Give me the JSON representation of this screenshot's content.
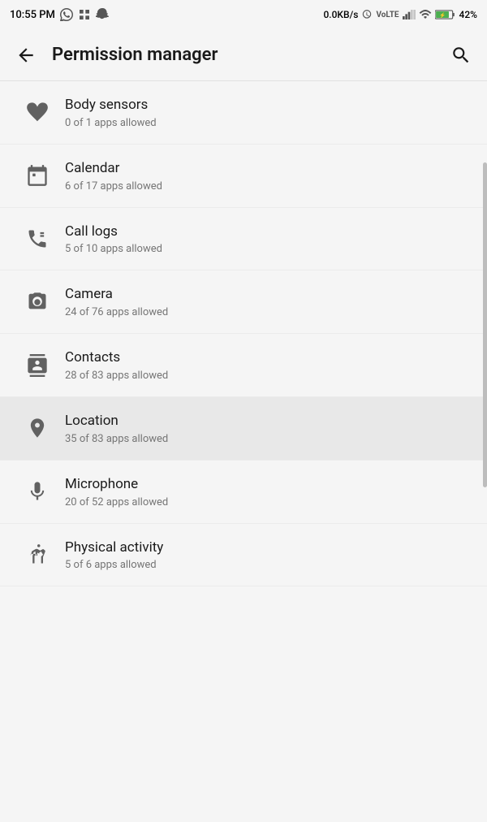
{
  "statusBar": {
    "time": "10:55 PM",
    "dataSpeed": "0.0KB/s",
    "battery": "42%"
  },
  "appBar": {
    "title": "Permission manager",
    "backLabel": "back",
    "searchLabel": "search"
  },
  "permissions": [
    {
      "id": "body-sensors",
      "name": "Body sensors",
      "sub": "0 of 1 apps allowed",
      "icon": "heart"
    },
    {
      "id": "calendar",
      "name": "Calendar",
      "sub": "6 of 17 apps allowed",
      "icon": "calendar"
    },
    {
      "id": "call-logs",
      "name": "Call logs",
      "sub": "5 of 10 apps allowed",
      "icon": "call-logs"
    },
    {
      "id": "camera",
      "name": "Camera",
      "sub": "24 of 76 apps allowed",
      "icon": "camera"
    },
    {
      "id": "contacts",
      "name": "Contacts",
      "sub": "28 of 83 apps allowed",
      "icon": "contacts"
    },
    {
      "id": "location",
      "name": "Location",
      "sub": "35 of 83 apps allowed",
      "icon": "location",
      "highlighted": true
    },
    {
      "id": "microphone",
      "name": "Microphone",
      "sub": "20 of 52 apps allowed",
      "icon": "microphone"
    },
    {
      "id": "physical-activity",
      "name": "Physical activity",
      "sub": "5 of 6 apps allowed",
      "icon": "running"
    }
  ]
}
